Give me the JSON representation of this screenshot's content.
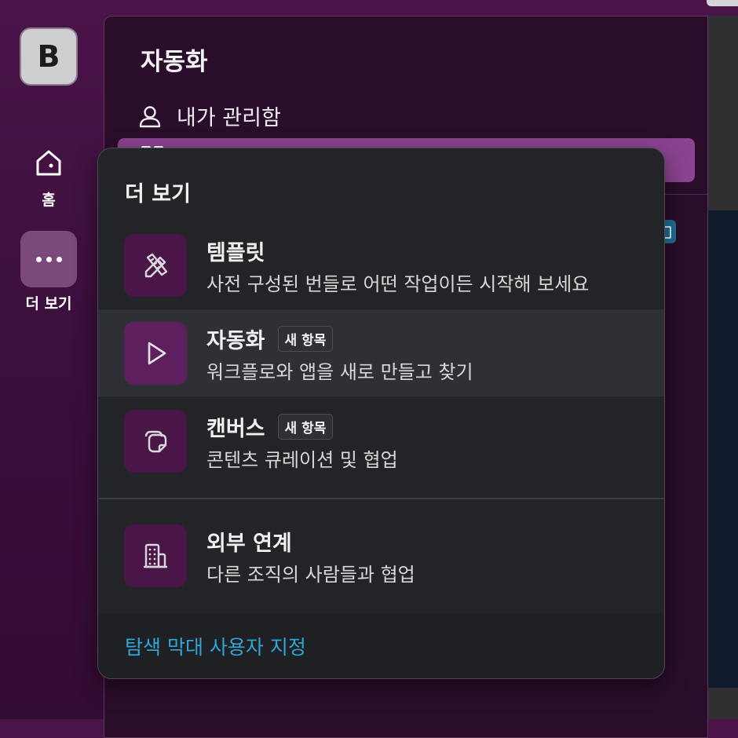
{
  "workspace": {
    "initial": "B"
  },
  "rail": {
    "home_label": "홈",
    "more_label": "더 보기"
  },
  "sidebar": {
    "title": "자동화",
    "row_label": "내가 관리함"
  },
  "popup": {
    "title": "더 보기",
    "items": [
      {
        "title": "템플릿",
        "badge": "",
        "description": "사전 구성된 번들로 어떤 작업이든 시작해 보세요",
        "icon": "template-pencil-ruler-icon"
      },
      {
        "title": "자동화",
        "badge": "새 항목",
        "description": "워크플로와 앱을 새로 만들고 찾기",
        "icon": "play-icon"
      },
      {
        "title": "캔버스",
        "badge": "새 항목",
        "description": "콘텐츠 큐레이션 및 협업",
        "icon": "canvas-icon"
      },
      {
        "title": "외부 연계",
        "badge": "",
        "description": "다른 조직의 사람들과 협업",
        "icon": "building-icon"
      }
    ],
    "footer_link": "탐색 막대 사용자 지정"
  },
  "colors": {
    "rail_background": "#3c0f3d",
    "sidebar_background": "#2a0d2b",
    "selected_row": "#8b4390",
    "popup_background": "#222427",
    "icon_tile": "#4a1547",
    "link": "#2ea7d8"
  }
}
